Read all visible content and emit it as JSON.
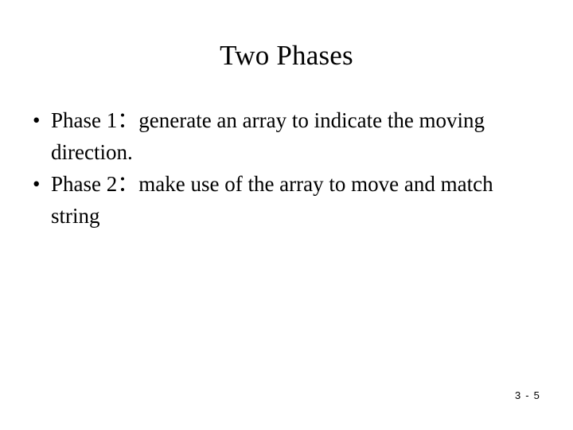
{
  "slide": {
    "title": "Two Phases",
    "background_color": "#ffffff",
    "text_color": "#000000",
    "bullet_glyph": "•",
    "bullets": [
      {
        "label": "Phase 1",
        "separator": "：",
        "description": "generate an array to indicate the moving direction.",
        "full_text": "Phase 1：generate an array to indicate the moving direction."
      },
      {
        "label": "Phase 2",
        "separator": "：",
        "description": "make use of the array to move and match string",
        "full_text": "Phase 2：make use of the array to move and match string"
      }
    ],
    "slide_number": "3 - 5"
  }
}
